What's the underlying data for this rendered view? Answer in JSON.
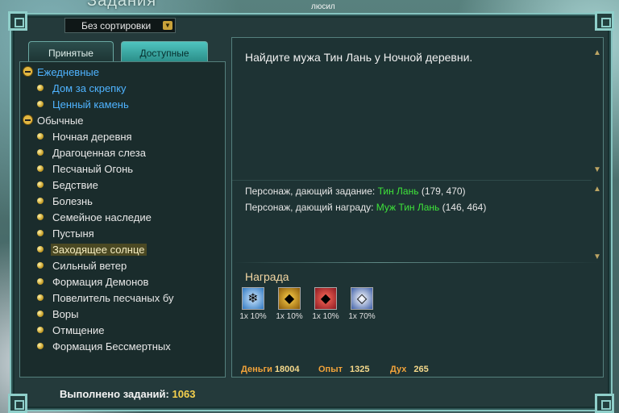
{
  "window": {
    "title": "Задания",
    "top_mark": "люсил"
  },
  "sort": {
    "selected": "Без сортировки"
  },
  "tabs": [
    {
      "label": "Принятые",
      "active": false
    },
    {
      "label": "Доступные",
      "active": true
    }
  ],
  "quest_list": {
    "daily": {
      "label": "Ежедневные",
      "items": [
        "Дом за скрепку",
        "Ценный камень"
      ]
    },
    "normal": {
      "label": "Обычные",
      "items": [
        "Ночная деревня",
        "Драгоценная слеза",
        "Песчаный Огонь",
        "Бедствие",
        "Болезнь",
        "Семейное наследие",
        "Пустыня",
        "Заходящее солнце",
        "Сильный ветер",
        "Формация Демонов",
        "Повелитель песчаных бу",
        "Воры",
        "Отмщение",
        "Формация Бессмертных"
      ],
      "selected_index": 7
    }
  },
  "details": {
    "description": "Найдите мужа Тин Лань у Ночной деревни.",
    "giver_label": "Персонаж, дающий задание: ",
    "giver_name": "Тин Лань",
    "giver_coords": " (179, 470)",
    "rewarder_label": "Персонаж, дающий награду: ",
    "rewarder_name": "Муж Тин Лань",
    "rewarder_coords": " (146, 464)"
  },
  "rewards": {
    "title": "Награда",
    "items": [
      {
        "label": "1x 10%",
        "icon": "crystal-icon",
        "color": "#2f78c0"
      },
      {
        "label": "1x 10%",
        "icon": "gold-ore-icon",
        "color": "#8a5a0a"
      },
      {
        "label": "1x 10%",
        "icon": "ruby-icon",
        "color": "#8c1a22"
      },
      {
        "label": "1x 70%",
        "icon": "silver-gem-icon",
        "color": "#3e5fa8"
      }
    ],
    "money_label": "Деньги",
    "money_value": "18004",
    "exp_label": "Опыт",
    "exp_value": "1325",
    "spirit_label": "Дух",
    "spirit_value": "265"
  },
  "footer": {
    "completed_label": "Выполнено заданий:",
    "completed_value": "1063"
  },
  "colors": {
    "accent": "#4fc4bf",
    "daily": "#4fb3ff",
    "npc_name": "#3ee43a",
    "stat_label": "#f2a33a"
  }
}
